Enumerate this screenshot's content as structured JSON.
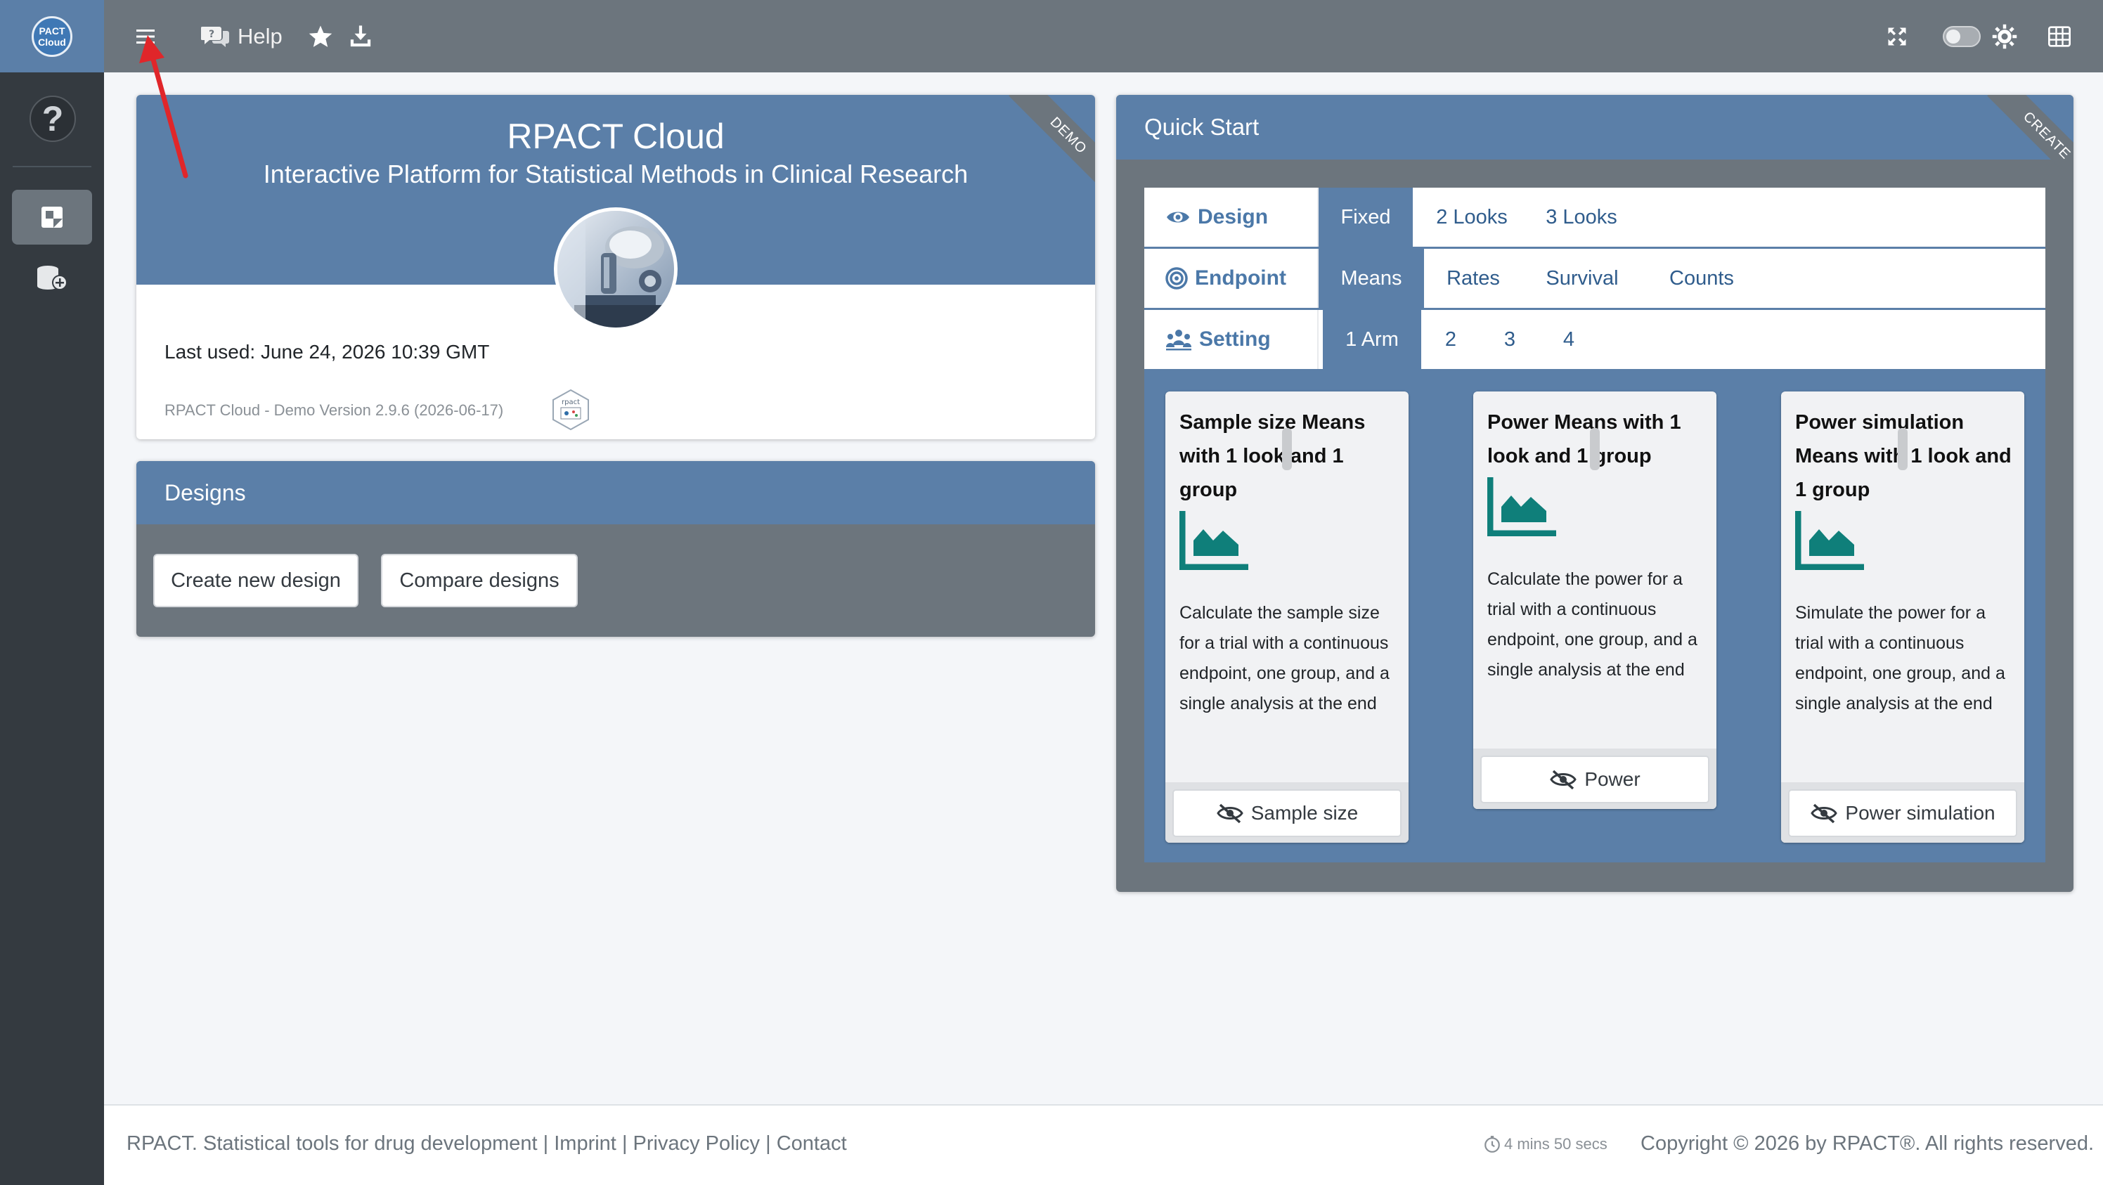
{
  "brand": {
    "logo_line1": "PACT",
    "logo_line2": "Cloud"
  },
  "navbar": {
    "help_label": "Help"
  },
  "welcome": {
    "title": "RPACT Cloud",
    "subtitle": "Interactive Platform for Statistical Methods in Clinical Research",
    "ribbon": "DEMO",
    "last_used": "Last used: June 24, 2026 10:39 GMT",
    "version": "RPACT Cloud - Demo Version 2.9.6 (2026-06-17)",
    "hex_logo_text": "rpact"
  },
  "designs": {
    "title": "Designs",
    "create_label": "Create new design",
    "compare_label": "Compare designs"
  },
  "quick_start": {
    "title": "Quick Start",
    "ribbon": "CREATE",
    "design": {
      "label": "Design",
      "options": [
        "Fixed",
        "2 Looks",
        "3 Looks"
      ],
      "selected": "Fixed"
    },
    "endpoint": {
      "label": "Endpoint",
      "options": [
        "Means",
        "Rates",
        "Survival",
        "Counts"
      ],
      "selected": "Means"
    },
    "setting": {
      "label": "Setting",
      "options": [
        "1 Arm",
        "2",
        "3",
        "4"
      ],
      "selected": "1 Arm"
    },
    "cards": [
      {
        "title": "Sample size Means with 1 look and 1 group",
        "description": "Calculate the sample size for a trial with a continuous endpoint, one group, and a single analysis at the end",
        "button": "Sample size"
      },
      {
        "title": "Power Means with 1 look and 1 group",
        "description": "Calculate the power for a trial with a continuous endpoint, one group, and a single analysis at the end",
        "button": "Power"
      },
      {
        "title": "Power simulation Means with 1 look and 1 group",
        "description": "Simulate the power for a trial with a continuous endpoint, one group, and a single analysis at the end",
        "button": "Power simulation"
      }
    ],
    "icon_color": "#0f7f7a"
  },
  "footer": {
    "tagline": "RPACT. Statistical tools for drug development",
    "imprint": "Imprint",
    "privacy": "Privacy Policy",
    "contact": "Contact",
    "separator": "|",
    "session_timer": "4 mins 50 secs",
    "copyright": "Copyright © 2026 by RPACT®. All rights reserved."
  },
  "colors": {
    "primary": "#5b7fa8",
    "navbar": "#6c757d",
    "sidebar": "#343a40",
    "annotation_arrow": "#e0262a"
  }
}
